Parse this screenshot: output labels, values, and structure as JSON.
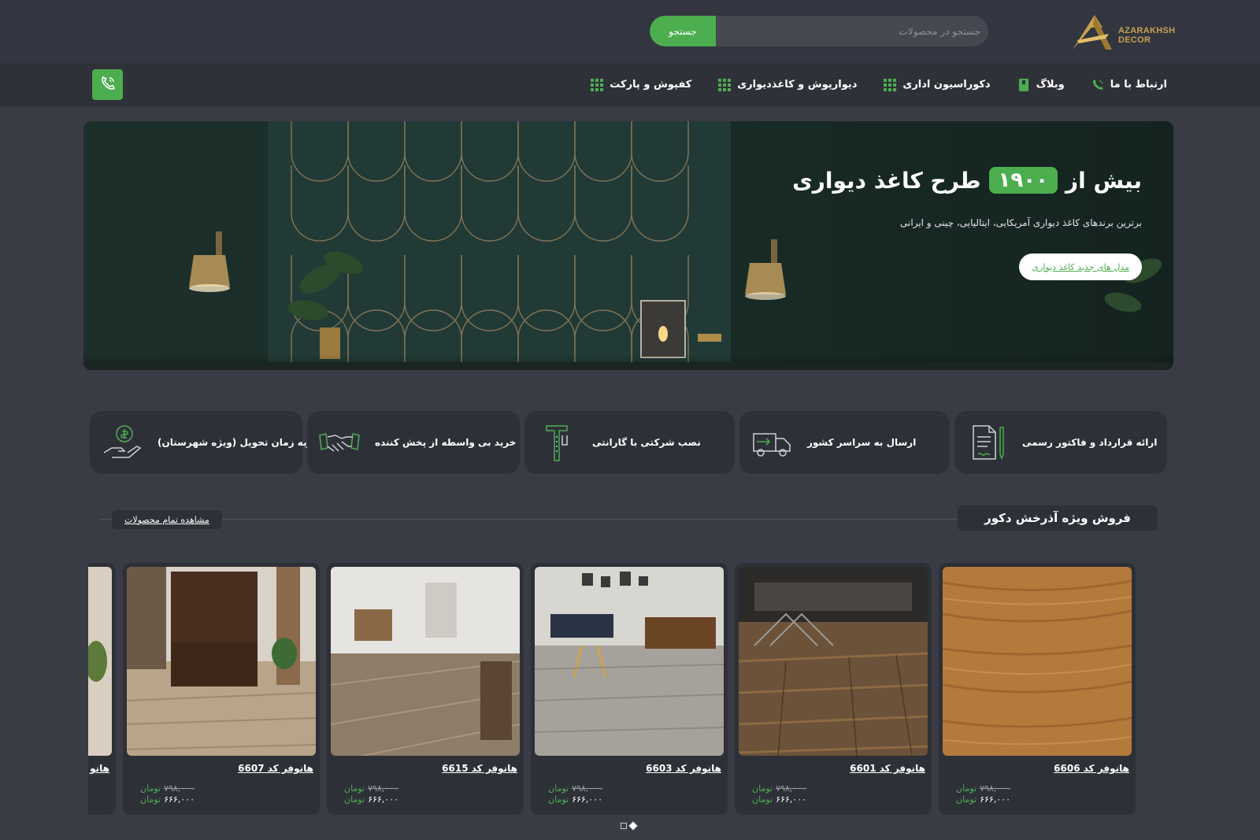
{
  "brand": {
    "name_line1": "AZARAKHSH",
    "name_line2": "DECOR"
  },
  "search": {
    "placeholder": "جستجو در محصولات",
    "button": "جستجو"
  },
  "nav": {
    "items": [
      {
        "label": "کفپوش و پارکت",
        "icon": "grid-icon"
      },
      {
        "label": "دیوارپوش و کاغذدیواری",
        "icon": "grid-icon"
      },
      {
        "label": "دکوراسیون اداری",
        "icon": "grid-icon"
      },
      {
        "label": "وبلاگ",
        "icon": "bookmark-icon"
      },
      {
        "label": "ارتباط با ما",
        "icon": "phone-icon"
      }
    ],
    "call_icon": "phone-call-icon"
  },
  "hero": {
    "title_prefix": "بیش از",
    "title_number": "۱۹۰۰",
    "title_suffix": "طرح کاغذ دیواری",
    "subtitle": "برترین برندهای کاغذ دیواری آمریکایی، ایتالیایی، چینی و ایرانی",
    "cta": "مدل های جدید کاغذ دیواری"
  },
  "features": [
    {
      "label": "ارائه قرارداد و فاکتور رسمی",
      "icon": "contract-icon"
    },
    {
      "label": "ارسال به سراسر کشور",
      "icon": "truck-icon"
    },
    {
      "label": "نصب شرکتی با گارانتی",
      "icon": "caliper-icon"
    },
    {
      "label": "خرید بی واسطه از پخش کننده",
      "icon": "handshake-icon"
    },
    {
      "label": "تسویه زمان تحویل (ویژه شهرستان)",
      "icon": "money-hand-icon"
    }
  ],
  "section": {
    "title": "فروش ویژه آذرخش دکور",
    "see_all": "مشاهده تمام محصولات"
  },
  "products": [
    {
      "name": "هانوفر کد 6606",
      "old_price": "۷۹۸,۰۰۰",
      "new_price": "۶۶۶,۰۰۰",
      "currency": "تومان"
    },
    {
      "name": "هانوفر کد 6601",
      "old_price": "۷۹۸,۰۰۰",
      "new_price": "۶۶۶,۰۰۰",
      "currency": "تومان"
    },
    {
      "name": "هانوفر کد 6603",
      "old_price": "۷۹۸,۰۰۰",
      "new_price": "۶۶۶,۰۰۰",
      "currency": "تومان"
    },
    {
      "name": "هانوفر کد 6615",
      "old_price": "۷۹۸,۰۰۰",
      "new_price": "۶۶۶,۰۰۰",
      "currency": "تومان"
    },
    {
      "name": "هانوفر کد 6607",
      "old_price": "۷۹۸,۰۰۰",
      "new_price": "۶۶۶,۰۰۰",
      "currency": "تومان"
    },
    {
      "name": "هانو",
      "old_price": "",
      "new_price": "",
      "currency": ""
    }
  ],
  "colors": {
    "accent": "#4cae4f",
    "bg": "#393b45",
    "card": "#2e3038",
    "gold": "#c8a24e"
  }
}
